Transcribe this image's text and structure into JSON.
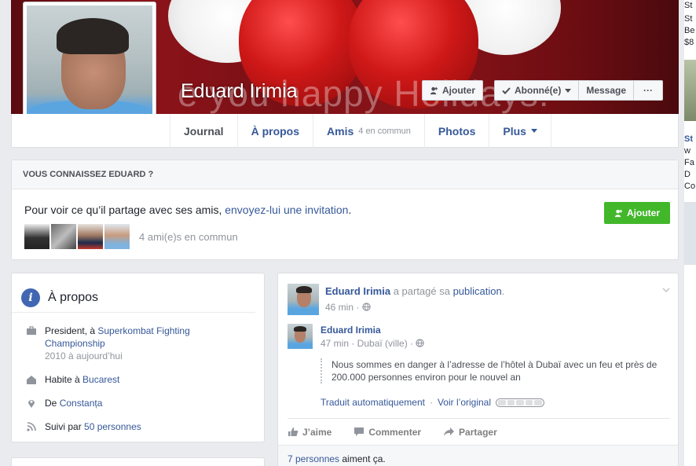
{
  "profile": {
    "name": "Eduard Irimia",
    "cover_text": "e you happy Holidays!"
  },
  "cover_actions": {
    "add_label": "Ajouter",
    "subscribed_label": "Abonné(e)",
    "message_label": "Message",
    "more_label": "···"
  },
  "tabs": [
    {
      "label": "Journal",
      "sub": ""
    },
    {
      "label": "À propos",
      "sub": ""
    },
    {
      "label": "Amis",
      "sub": "4 en commun"
    },
    {
      "label": "Photos",
      "sub": ""
    },
    {
      "label": "Plus",
      "sub": ""
    }
  ],
  "know": {
    "heading": "VOUS CONNAISSEZ EDUARD ?",
    "text_before": "Pour voir ce qu’il partage avec ses amis, ",
    "text_link": "envoyez-lui une invitation",
    "text_after": ".",
    "add_label": "Ajouter",
    "mutual_text": "4 ami(e)s en commun"
  },
  "about": {
    "title": "À propos",
    "work_prefix": "President, à ",
    "work_company": "Superkombat Fighting Championship",
    "work_dates": "2010 à aujourd’hui",
    "lives_prefix": "Habite à ",
    "lives_city": "Bucarest",
    "from_prefix": "De ",
    "from_city": "Constanța",
    "followed_prefix": "Suivi par ",
    "followed_count": "50 personnes"
  },
  "post": {
    "author": "Eduard Irimia",
    "shared_text": " a partagé sa ",
    "shared_link": "publication",
    "shared_end": ".",
    "time": "46 min · ",
    "inner_author": "Eduard Irimia",
    "inner_time": "47 min · Dubaï (ville) · ",
    "body": "Nous sommes en danger à l’adresse de l’hôtel à Dubaï avec un feu et près de 200.000 personnes environ pour le nouvel an",
    "translate_label": "Traduit automatiquement",
    "see_original": "Voir l’original",
    "like_label": "J’aime",
    "comment_label": "Commenter",
    "share_label": "Partager",
    "likes_count": "7 personnes",
    "likes_suffix": " aiment ça."
  },
  "right_strip": [
    "St",
    "St",
    "Be",
    "$8",
    "St",
    "w",
    "Fa",
    "D",
    "Co"
  ]
}
